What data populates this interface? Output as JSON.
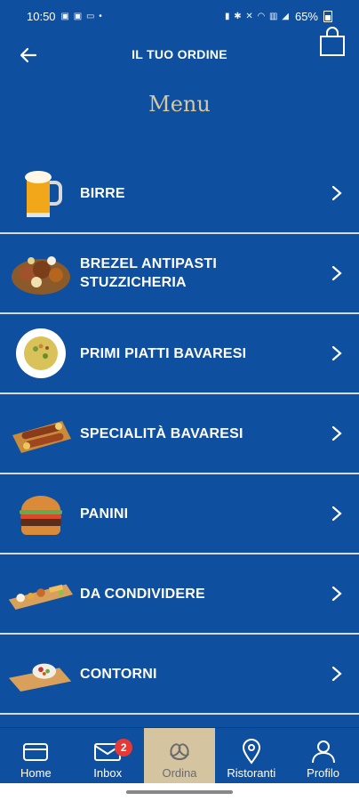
{
  "status": {
    "time": "10:50",
    "battery": "65%"
  },
  "header": {
    "title": "IL TUO ORDINE"
  },
  "menu_heading": "Menu",
  "categories": [
    {
      "label": "BIRRE",
      "icon": "beer-mug-icon"
    },
    {
      "label": "BREZEL ANTIPASTI STUZZICHERIA",
      "icon": "pretzel-platter-icon"
    },
    {
      "label": "PRIMI PIATTI BAVARESI",
      "icon": "pasta-plate-icon"
    },
    {
      "label": "SPECIALITÀ BAVARESI",
      "icon": "sausage-board-icon"
    },
    {
      "label": "PANINI",
      "icon": "burger-icon"
    },
    {
      "label": "DA CONDIVIDERE",
      "icon": "sharing-board-icon"
    },
    {
      "label": "CONTORNI",
      "icon": "side-dish-icon"
    }
  ],
  "bottom_nav": [
    {
      "label": "Home",
      "icon": "card-icon"
    },
    {
      "label": "Inbox",
      "icon": "inbox-icon",
      "badge": "2"
    },
    {
      "label": "Ordina",
      "icon": "pretzel-icon",
      "active": true
    },
    {
      "label": "Ristoranti",
      "icon": "location-pin-icon"
    },
    {
      "label": "Profilo",
      "icon": "user-icon"
    }
  ],
  "colors": {
    "background": "#0e4fa0",
    "menu_heading": "#d8c79b",
    "active_tab": "#d4c4a0",
    "badge": "#e53935"
  }
}
